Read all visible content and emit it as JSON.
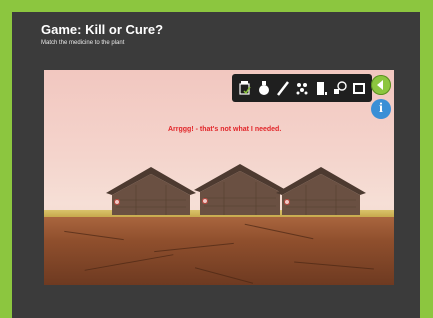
{
  "header": {
    "title": "Game: Kill or Cure?",
    "subtitle": "Match the medicine to the plant"
  },
  "game": {
    "message": "Arrggg! - that's not what I needed.",
    "toolbar_items": [
      {
        "name": "jar-icon"
      },
      {
        "name": "flask-icon"
      },
      {
        "name": "syringe-icon"
      },
      {
        "name": "pellets-icon"
      },
      {
        "name": "bottle-icon"
      },
      {
        "name": "capsule-icon"
      },
      {
        "name": "box-icon"
      }
    ],
    "huts": [
      {
        "name": "hut-left"
      },
      {
        "name": "hut-middle"
      },
      {
        "name": "hut-right"
      }
    ]
  },
  "colors": {
    "page_border": "#8cc63f",
    "panel": "#3b3b3b",
    "message_red": "#e2262a",
    "info_blue": "#3a8fd6"
  }
}
